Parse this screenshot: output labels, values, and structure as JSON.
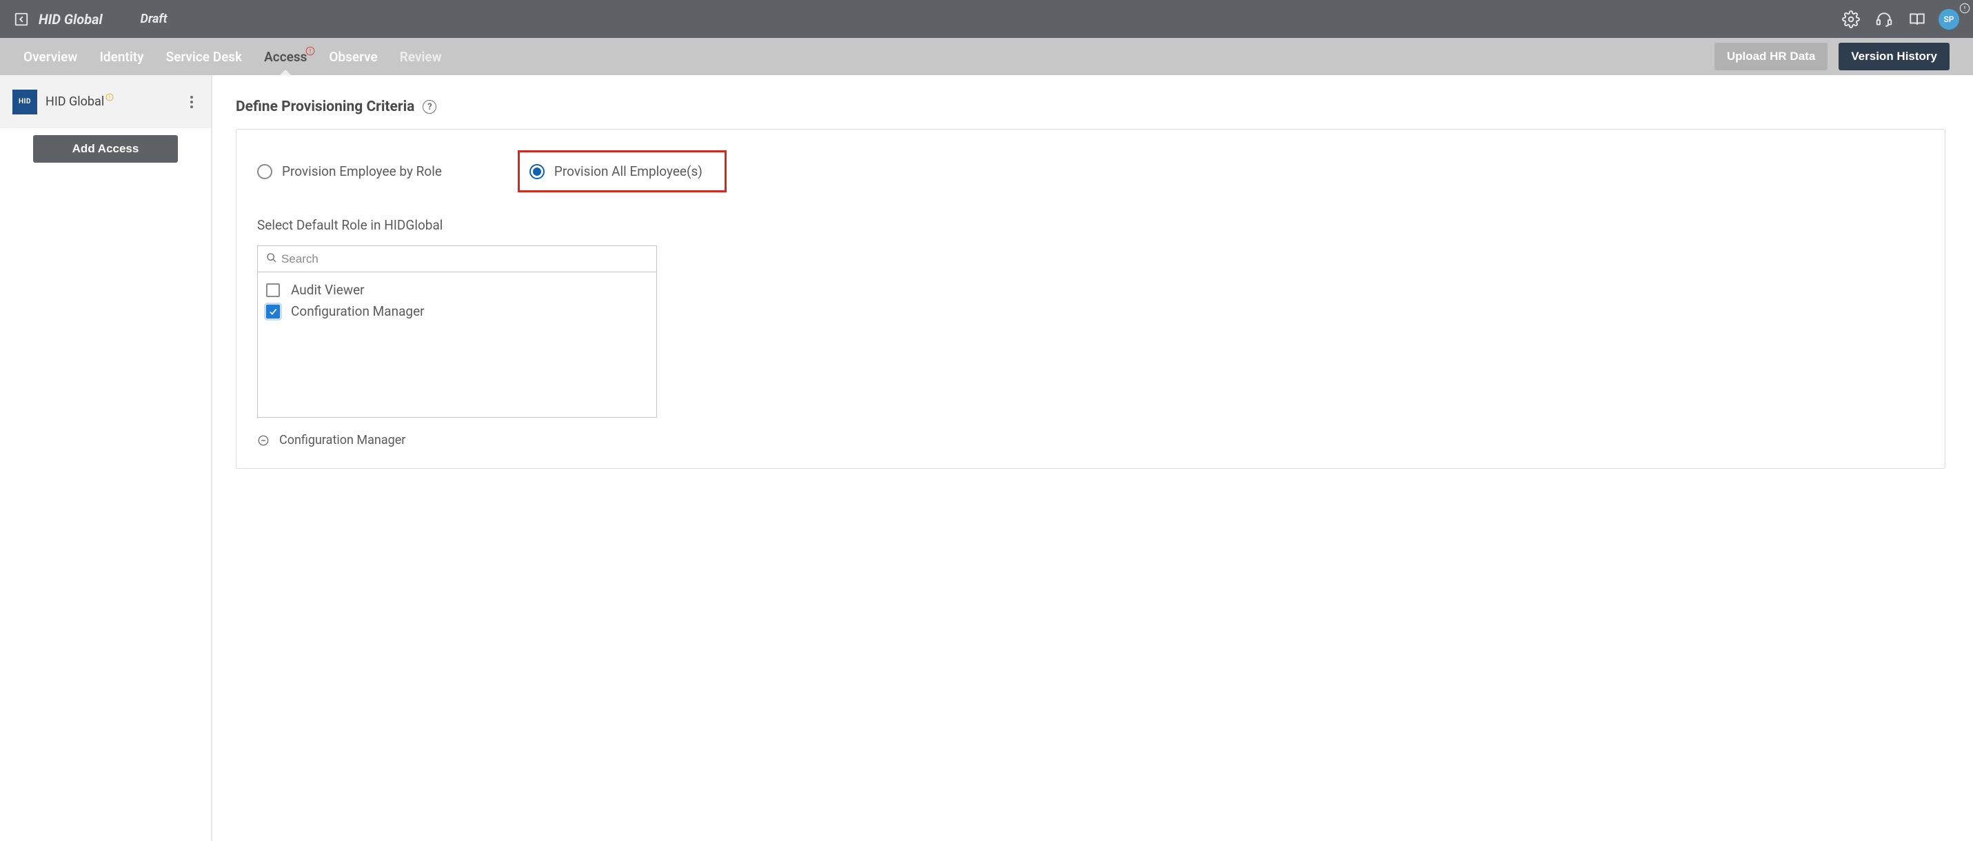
{
  "header": {
    "app_title": "HID Global",
    "draft_label": "Draft",
    "avatar_initials": "SP"
  },
  "tabs": {
    "items": [
      {
        "label": "Overview"
      },
      {
        "label": "Identity"
      },
      {
        "label": "Service Desk"
      },
      {
        "label": "Access"
      },
      {
        "label": "Observe"
      },
      {
        "label": "Review"
      }
    ],
    "upload_label": "Upload HR Data",
    "history_label": "Version History"
  },
  "sidebar": {
    "logo_text": "HID",
    "app_name": "HID Global",
    "add_access_label": "Add Access"
  },
  "main": {
    "section_title": "Define Provisioning Criteria",
    "radios": {
      "by_role": "Provision Employee by Role",
      "all": "Provision All Employee(s)"
    },
    "default_role_label": "Select Default Role in HIDGlobal",
    "search_placeholder": "Search",
    "roles": [
      {
        "label": "Audit Viewer",
        "checked": false
      },
      {
        "label": "Configuration Manager",
        "checked": true
      }
    ],
    "chip_label": "Configuration Manager"
  }
}
